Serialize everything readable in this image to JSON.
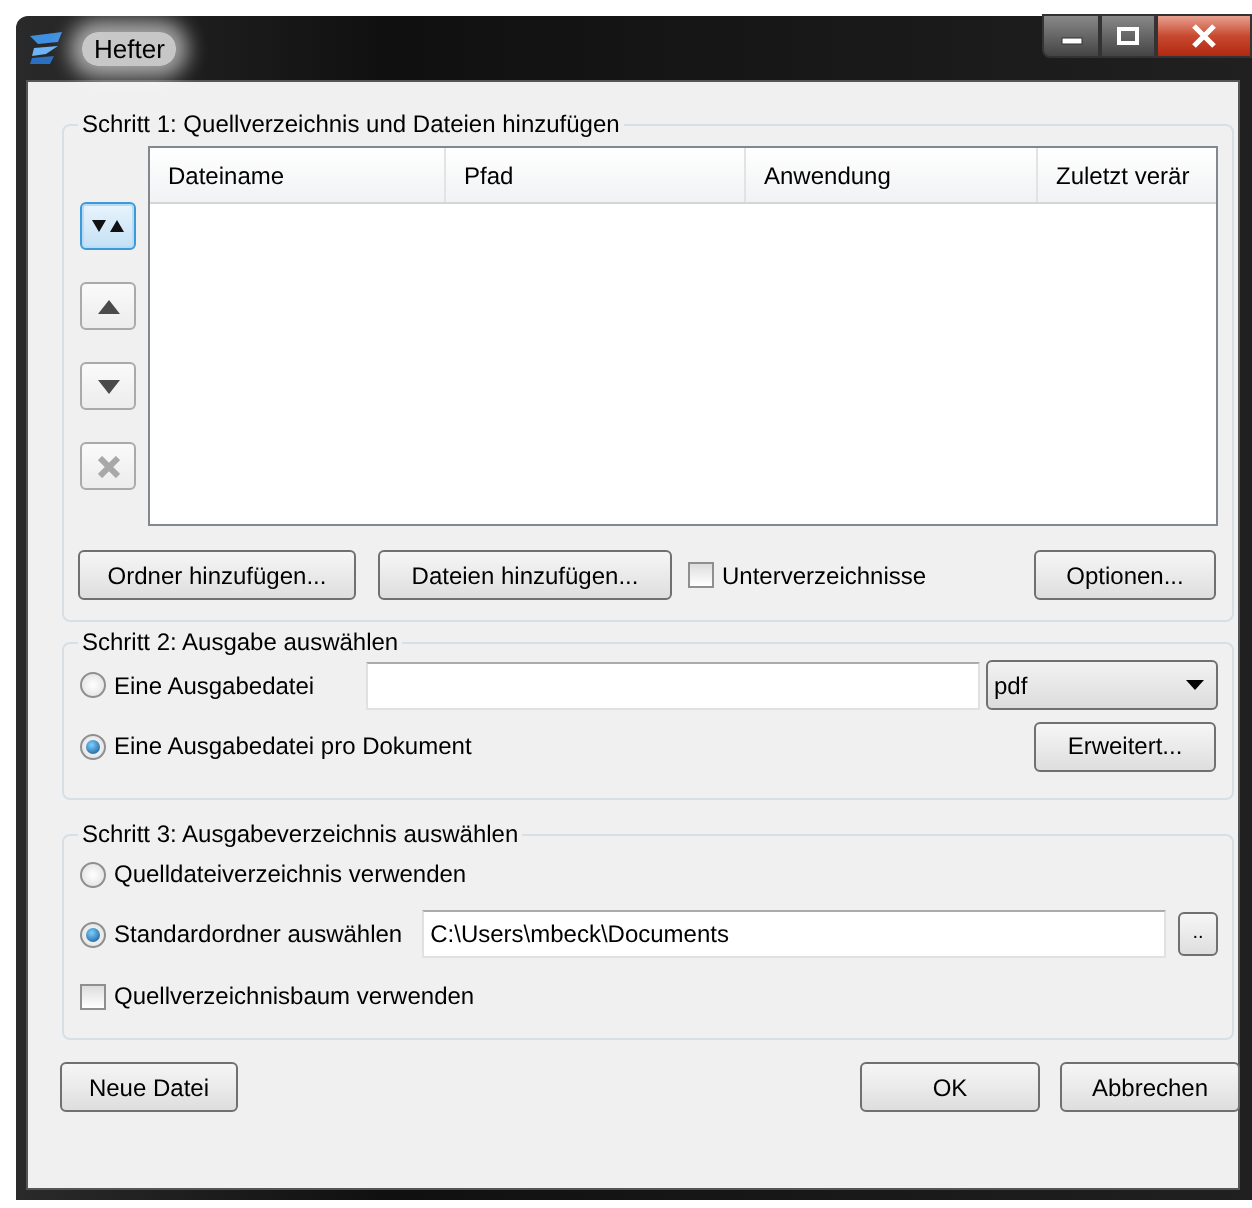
{
  "window": {
    "title": "Hefter"
  },
  "step1": {
    "title": "Schritt 1: Quellverzeichnis und Dateien hinzufügen",
    "columns": [
      "Dateiname",
      "Pfad",
      "Anwendung",
      "Zuletzt verär"
    ],
    "side_buttons": [
      {
        "kind": "sort",
        "focused": true,
        "disabled": false
      },
      {
        "kind": "up",
        "focused": false,
        "disabled": false
      },
      {
        "kind": "down",
        "focused": false,
        "disabled": false
      },
      {
        "kind": "remove",
        "focused": false,
        "disabled": true
      }
    ],
    "add_folder": "Ordner hinzufügen...",
    "add_files": "Dateien hinzufügen...",
    "subfolders": {
      "label": "Unterverzeichnisse",
      "checked": false
    },
    "options": "Optionen..."
  },
  "step2": {
    "title": "Schritt 2: Ausgabe auswählen",
    "radios": [
      {
        "label": "Eine Ausgabedatei",
        "selected": false
      },
      {
        "label": "Eine Ausgabedatei pro Dokument",
        "selected": true
      }
    ],
    "format": "pdf",
    "advanced": "Erweitert..."
  },
  "step3": {
    "title": "Schritt 3: Ausgabeverzeichnis auswählen",
    "radios": [
      {
        "label": "Quelldateiverzeichnis verwenden",
        "selected": false
      },
      {
        "label": "Standardordner auswählen",
        "selected": true
      }
    ],
    "path": "C:\\Users\\mbeck\\Documents",
    "browse": "..",
    "tree": {
      "label": "Quellverzeichnisbaum verwenden",
      "checked": false
    }
  },
  "footer": [
    "Neue Datei",
    "OK",
    "Abbrechen"
  ]
}
